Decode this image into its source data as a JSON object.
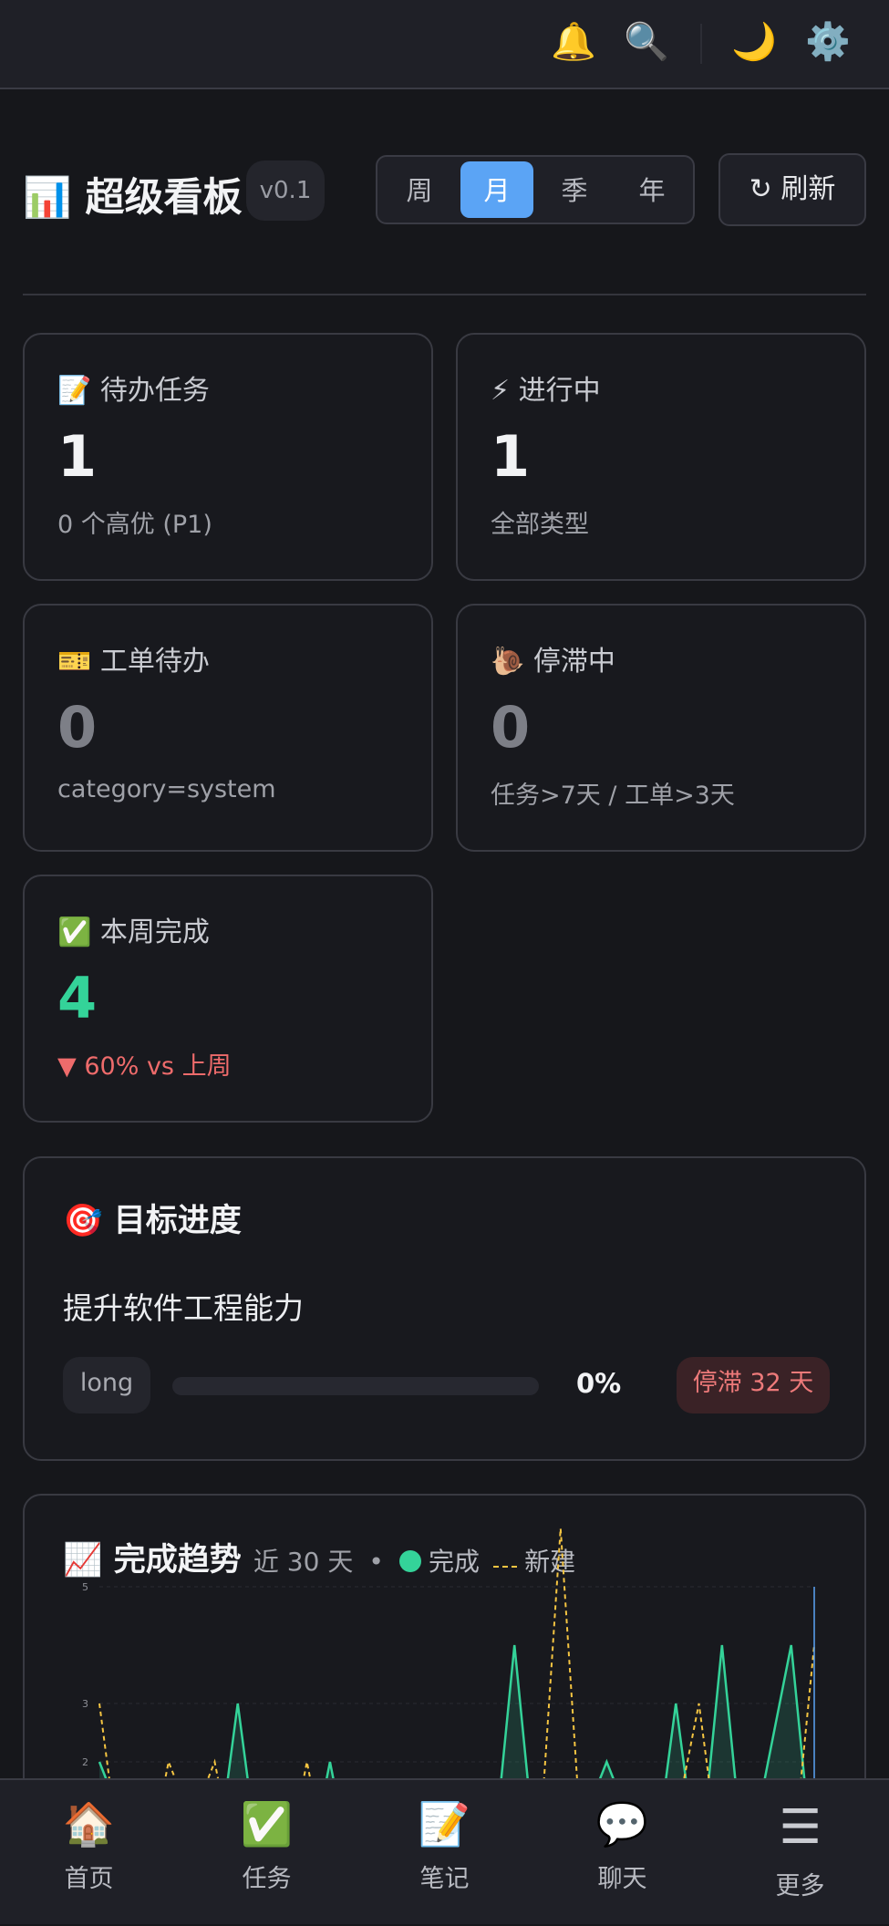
{
  "topbar": {
    "icons": {
      "bell": "🔔",
      "search": "🔍",
      "theme": "🌙",
      "settings": "⚙️"
    }
  },
  "header": {
    "icon": "📊",
    "title": "超级看板",
    "version": "v0.1",
    "periods": [
      "周",
      "月",
      "季",
      "年"
    ],
    "active_period": "月",
    "refresh_label": "↻ 刷新"
  },
  "stats": [
    {
      "icon": "📝",
      "label": "待办任务",
      "value": "1",
      "sub": "0 个高优 (P1)",
      "value_color": "#f2f3f5"
    },
    {
      "icon": "⚡",
      "label": "进行中",
      "value": "1",
      "sub": "全部类型",
      "value_color": "#f2f3f5"
    },
    {
      "icon": "🎫",
      "label": "工单待办",
      "value": "0",
      "sub": "category=system",
      "value_color": "#7d7f87"
    },
    {
      "icon": "🐌",
      "label": "停滞中",
      "value": "0",
      "sub": "任务>7天 / 工单>3天",
      "value_color": "#7d7f87"
    },
    {
      "icon": "✅",
      "label": "本周完成",
      "value": "4",
      "sub": "▼ 60% vs 上周",
      "value_color": "#34d399",
      "sub_color": "#ee6b6b"
    }
  ],
  "goals": {
    "icon": "🎯",
    "title": "目标进度",
    "items": [
      {
        "name": "提升软件工程能力",
        "tag": "long",
        "progress": 0,
        "percent_label": "0%",
        "status": "停滞 32 天"
      }
    ]
  },
  "trend": {
    "icon": "📈",
    "title": "完成趋势",
    "subtitle": "近 30 天",
    "sep": "•",
    "legend_done": "完成",
    "legend_new": "新建"
  },
  "chart_data": {
    "type": "line",
    "title": "完成趋势",
    "y_ticks": [
      "5",
      "3",
      "2"
    ],
    "y_tick_values": [
      5,
      3,
      2
    ],
    "series": [
      {
        "name": "完成",
        "color": "#34d399",
        "style": "solid-area",
        "values": [
          2,
          1,
          0,
          1,
          0,
          0,
          3,
          0,
          1,
          0,
          2,
          0,
          0,
          0,
          0,
          0,
          0,
          0,
          4,
          0,
          1,
          1,
          2,
          1,
          0,
          3,
          0,
          4,
          0,
          2,
          4,
          0
        ]
      },
      {
        "name": "新建",
        "color": "#f5c542",
        "style": "dashed",
        "values": [
          3,
          0,
          0,
          2,
          1,
          2,
          0,
          0,
          0,
          2,
          0,
          0,
          0,
          0,
          0,
          0,
          0,
          1,
          1,
          0,
          6,
          0,
          0,
          1,
          1,
          1,
          3,
          0,
          0,
          0,
          0,
          4
        ]
      }
    ]
  },
  "nav": [
    {
      "icon": "🏠",
      "label": "首页"
    },
    {
      "icon": "✅",
      "label": "任务"
    },
    {
      "icon": "📝",
      "label": "笔记"
    },
    {
      "icon": "💬",
      "label": "聊天"
    },
    {
      "icon": "☰",
      "label": "更多"
    }
  ]
}
